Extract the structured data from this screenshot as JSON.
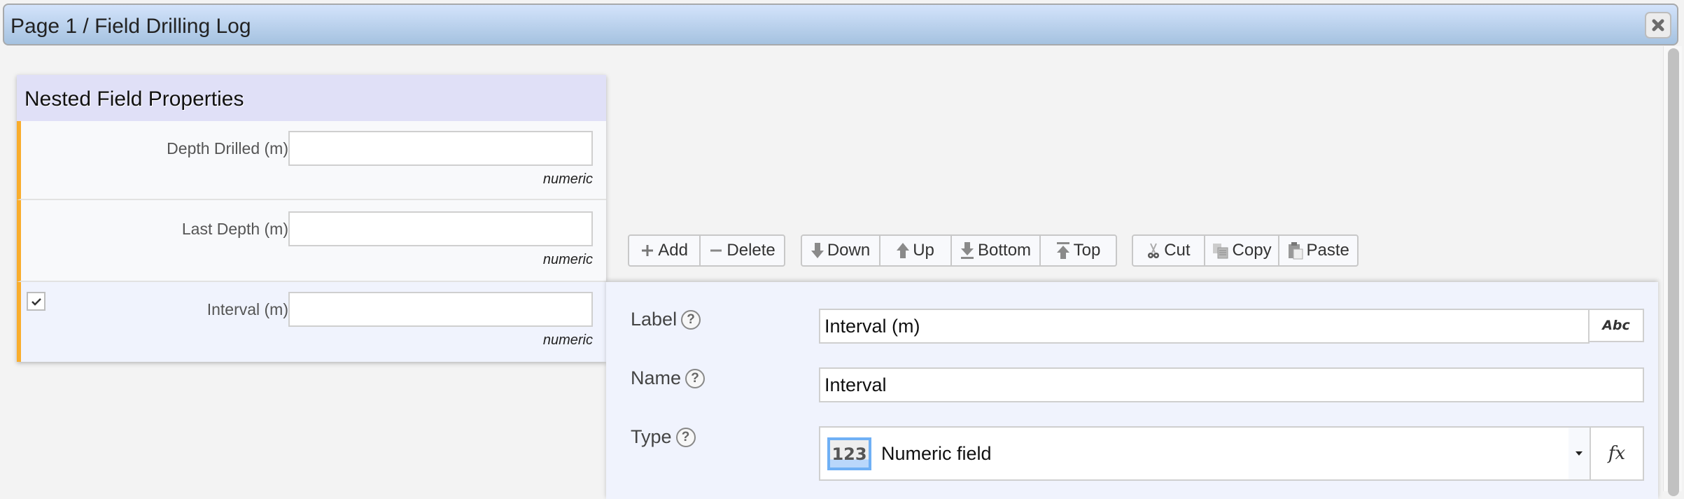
{
  "window": {
    "title": "Page 1 / Field Drilling Log",
    "close_icon": "close-icon"
  },
  "panel": {
    "title": "Nested Field Properties",
    "rows": [
      {
        "label": "Depth Drilled (m)",
        "value": "",
        "hint": "numeric",
        "selected": false
      },
      {
        "label": "Last Depth (m)",
        "value": "",
        "hint": "numeric",
        "selected": false
      },
      {
        "label": "Interval (m)",
        "value": "",
        "hint": "numeric",
        "selected": true,
        "checked": true
      }
    ]
  },
  "toolbar": {
    "add": "Add",
    "delete": "Delete",
    "down": "Down",
    "up": "Up",
    "bottom": "Bottom",
    "top": "Top",
    "cut": "Cut",
    "copy": "Copy",
    "paste": "Paste"
  },
  "editor": {
    "label_field": {
      "label": "Label",
      "value": "Interval (m)",
      "addon": "Abc"
    },
    "name_field": {
      "label": "Name",
      "value": "Interval"
    },
    "type_field": {
      "label": "Type",
      "icon_text": "123",
      "value": "Numeric field",
      "addon": "fx"
    },
    "help_glyph": "?"
  },
  "colors": {
    "accent_stripe": "#f9ad2c",
    "titlebar_top": "#d3e3fb",
    "titlebar_bottom": "#a5c2e0",
    "panel_header": "#e0e0f7",
    "selection_blue": "#6fb0f5"
  }
}
